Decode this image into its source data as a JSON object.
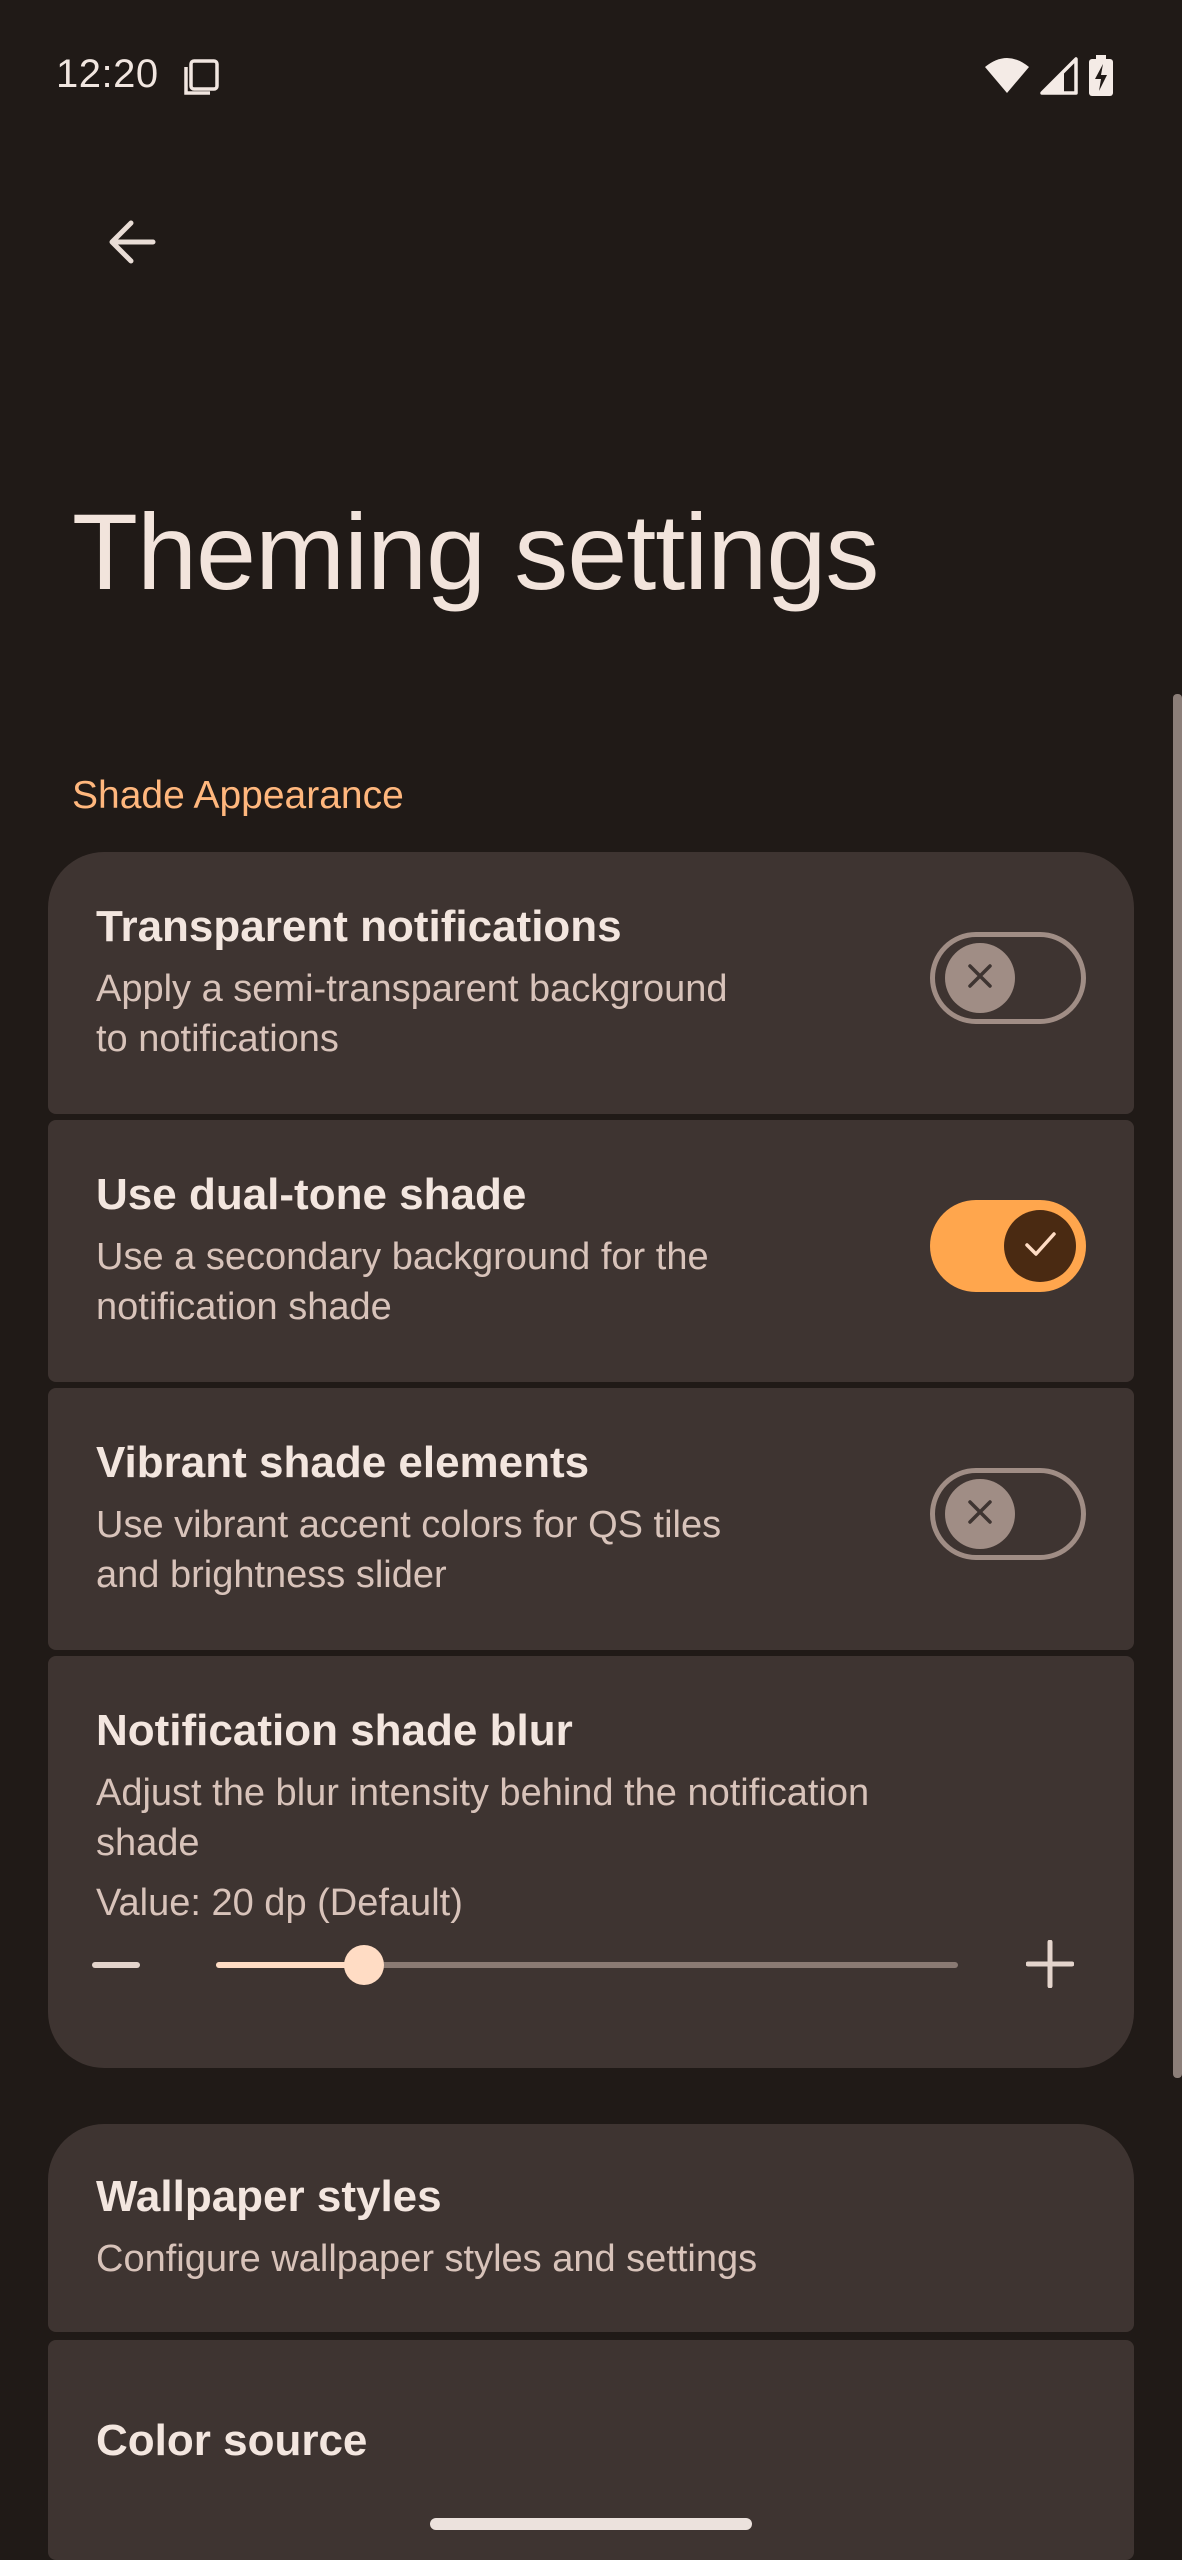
{
  "status_bar": {
    "time": "12:20"
  },
  "page": {
    "title": "Theming settings",
    "section_header": "Shade Appearance"
  },
  "settings": {
    "transparent_notifications": {
      "title": "Transparent notifications",
      "summary_line1": "Apply a semi-transparent background",
      "summary_line2": "to notifications",
      "enabled": false
    },
    "dual_tone_shade": {
      "title": "Use dual-tone shade",
      "summary_line1": "Use a secondary background for the",
      "summary_line2": "notification shade",
      "enabled": true
    },
    "vibrant_shade": {
      "title": "Vibrant shade elements",
      "summary_line1": "Use vibrant accent colors for QS tiles",
      "summary_line2": "and brightness slider",
      "enabled": false
    },
    "shade_blur": {
      "title": "Notification shade blur",
      "summary_line1": "Adjust the blur intensity behind the notification",
      "summary_line2": "shade",
      "value_text": "Value: 20 dp (Default)",
      "slider_fraction": 0.2
    },
    "wallpaper_styles": {
      "title": "Wallpaper styles",
      "summary": "Configure wallpaper styles and settings"
    },
    "color_source": {
      "title": "Color source"
    }
  },
  "colors": {
    "background": "#201a17",
    "card": "#3e3431",
    "accent": "#ffb77d",
    "switch_on": "#ffa64d"
  },
  "icons": {
    "back": "arrow-back-icon",
    "screenshot": "screenshot-icon",
    "wifi": "wifi-icon",
    "signal": "cell-signal-icon",
    "battery": "battery-charging-icon"
  }
}
